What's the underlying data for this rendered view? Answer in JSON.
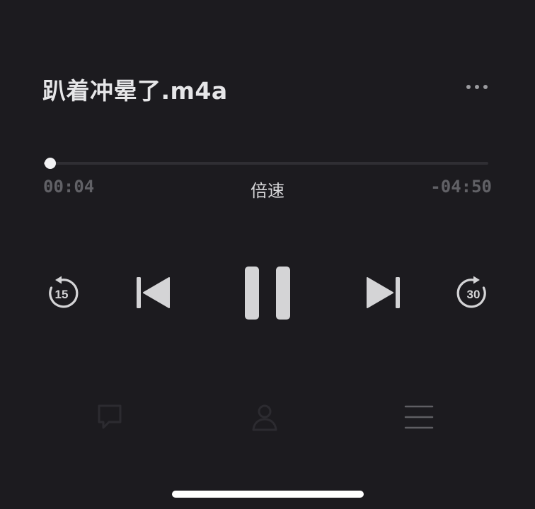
{
  "track": {
    "title": "趴着冲晕了.m4a"
  },
  "playback": {
    "elapsed": "00:04",
    "remaining": "-04:50",
    "progress_fraction": 0.014,
    "speed_label": "倍速",
    "is_playing": true
  },
  "controls": {
    "skip_back_seconds": "15",
    "skip_forward_seconds": "30"
  },
  "icons": {
    "more": "more-horizontal-icon",
    "skip_back": "rewind-15-icon",
    "previous": "previous-track-icon",
    "pause": "pause-icon",
    "next": "next-track-icon",
    "skip_forward": "forward-30-icon",
    "tab_left": "chat-bubble-icon",
    "tab_center": "person-icon",
    "tab_right": "list-icon"
  },
  "colors": {
    "background": "#1c1b1f",
    "control": "#d4d4d6",
    "dim": "#5f5e63",
    "faint_icon": "#2c2b30"
  }
}
